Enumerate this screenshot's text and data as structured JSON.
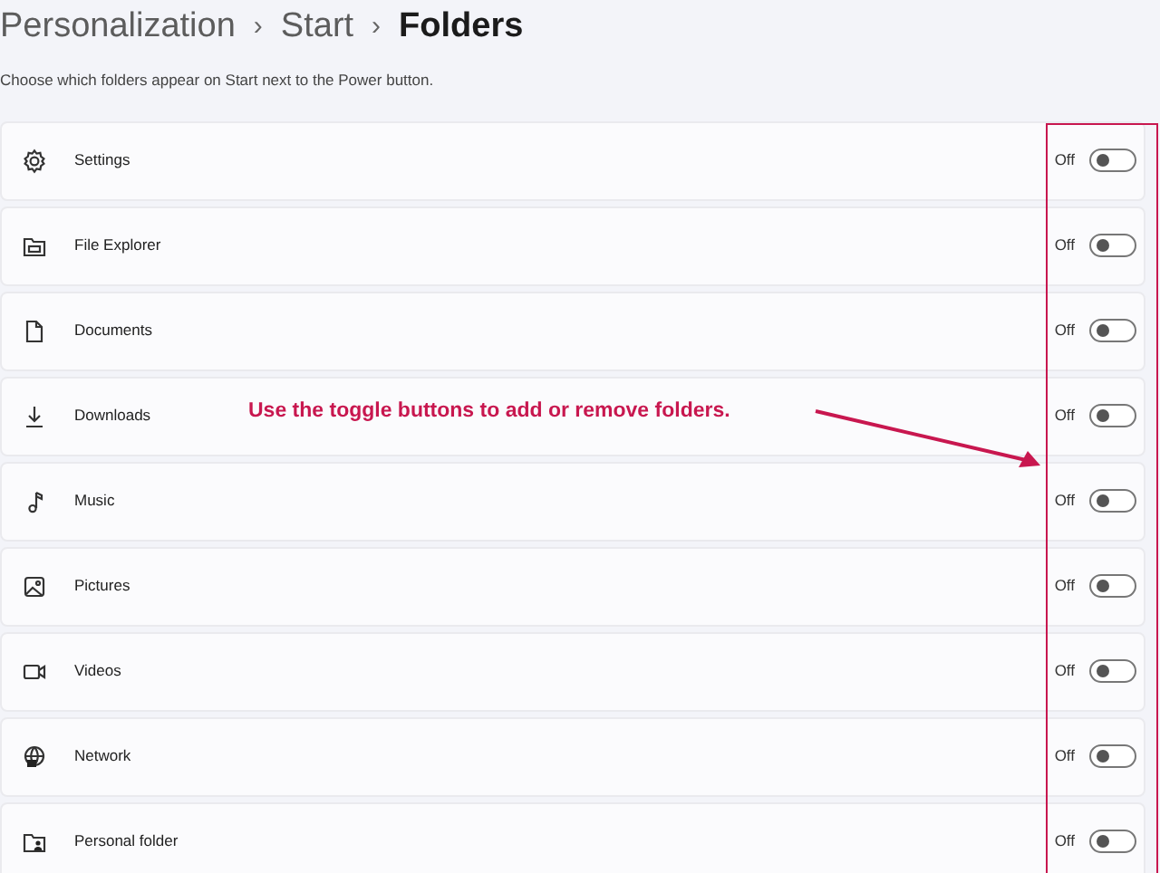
{
  "breadcrumb": [
    "Personalization",
    "Start",
    "Folders"
  ],
  "breadcrumb_separator": "›",
  "description": "Choose which folders appear on Start next to the Power button.",
  "folders": [
    {
      "label": "Settings",
      "state_text": "Off",
      "on": false
    },
    {
      "label": "File Explorer",
      "state_text": "Off",
      "on": false
    },
    {
      "label": "Documents",
      "state_text": "Off",
      "on": false
    },
    {
      "label": "Downloads",
      "state_text": "Off",
      "on": false
    },
    {
      "label": "Music",
      "state_text": "Off",
      "on": false
    },
    {
      "label": "Pictures",
      "state_text": "Off",
      "on": false
    },
    {
      "label": "Videos",
      "state_text": "Off",
      "on": false
    },
    {
      "label": "Network",
      "state_text": "Off",
      "on": false
    },
    {
      "label": "Personal folder",
      "state_text": "Off",
      "on": false
    }
  ],
  "annotation": {
    "text": "Use the toggle buttons to add or remove folders."
  }
}
